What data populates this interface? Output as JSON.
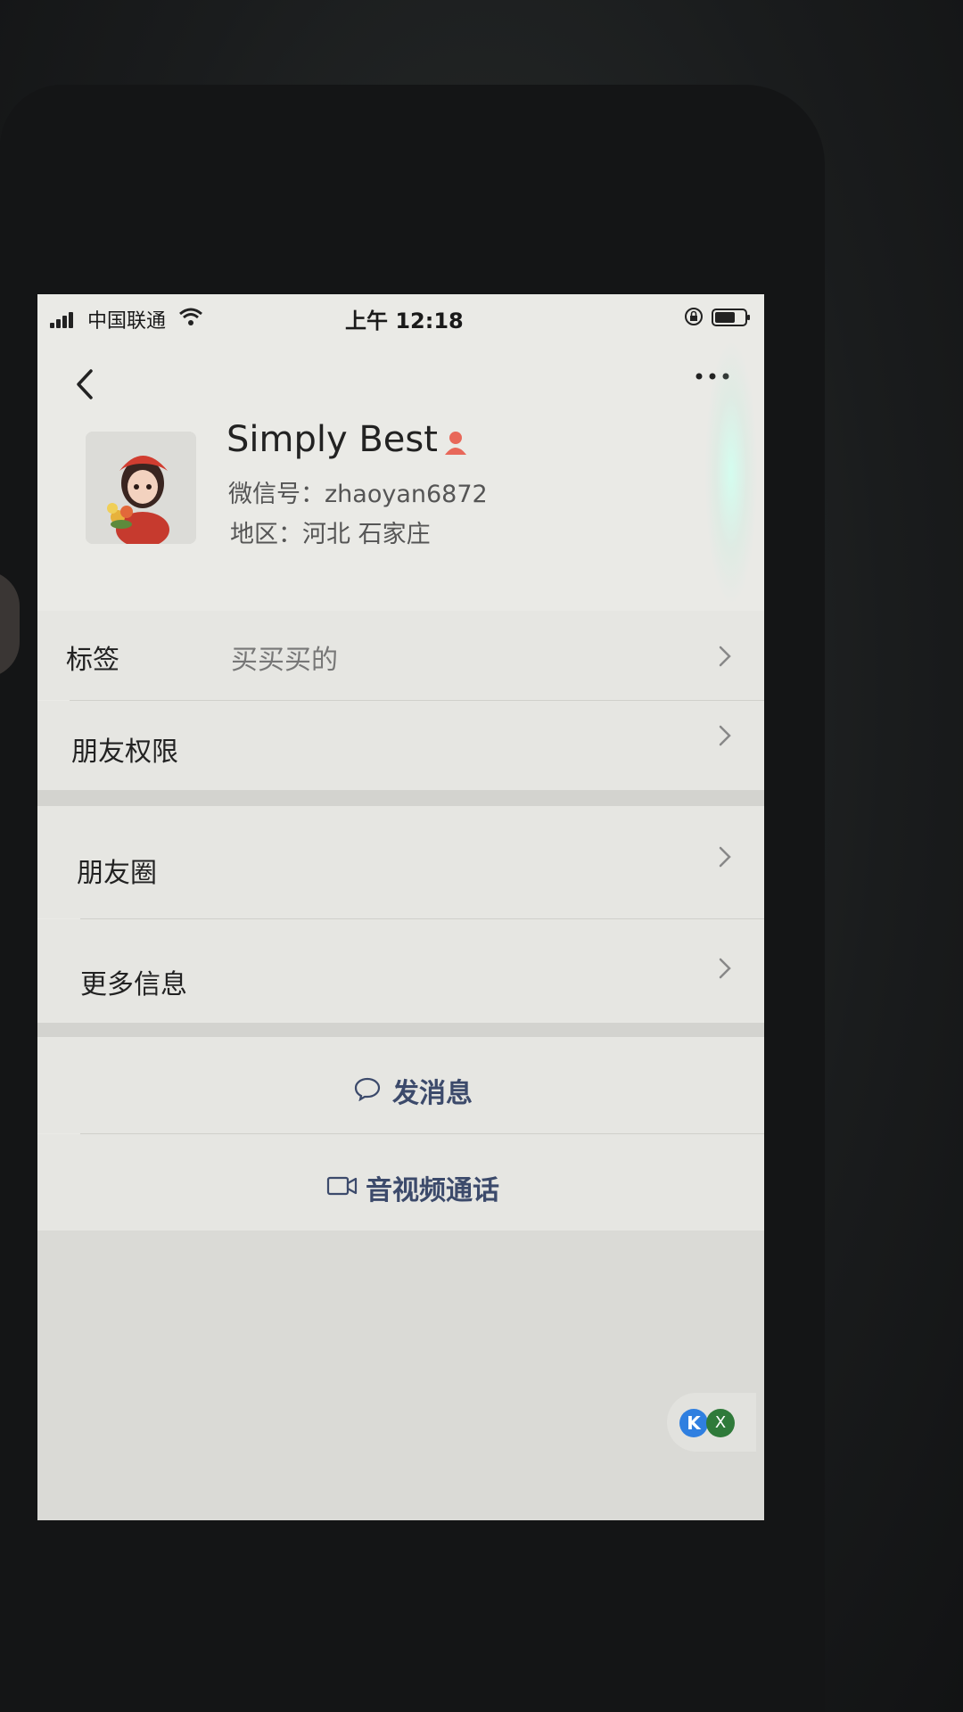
{
  "status_bar": {
    "carrier": "中国联通",
    "time": "上午 12:18"
  },
  "profile": {
    "name": "Simply Best",
    "wechat_id": "微信号：zhaoyan6872",
    "region": "地区：河北 石家庄",
    "gender_icon": "female-icon",
    "accent_color": "#e8685a"
  },
  "rows": {
    "tags_label": "标签",
    "tags_value": "买买买的",
    "permissions_label": "朋友权限",
    "moments_label": "朋友圈",
    "more_info_label": "更多信息"
  },
  "actions": {
    "message_label": "发消息",
    "call_label": "音视频通话",
    "action_color": "#3c4a6b"
  },
  "widget": {
    "left_badge": "K",
    "right_badge": "X"
  }
}
